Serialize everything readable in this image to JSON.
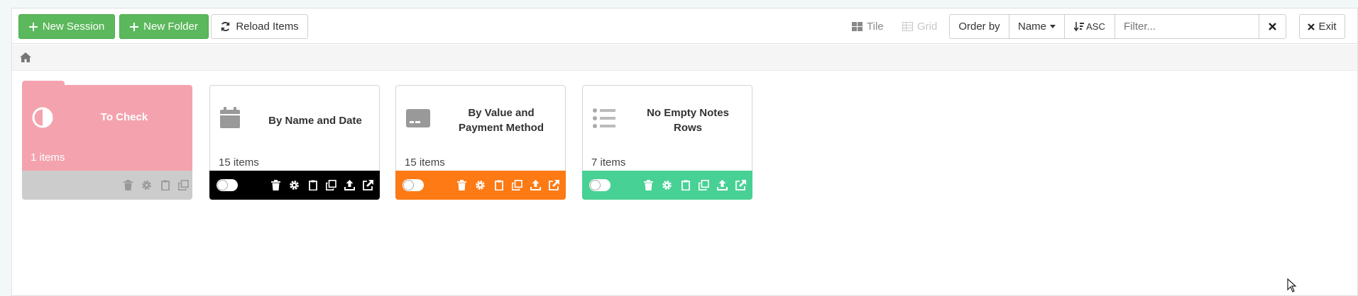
{
  "toolbar": {
    "new_session": "New Session",
    "new_folder": "New Folder",
    "reload_items": "Reload Items",
    "view_tile": "Tile",
    "view_grid": "Grid",
    "order_by_label": "Order by",
    "order_by_value": "Name",
    "sort_direction": "ASC",
    "filter_placeholder": "Filter...",
    "exit": "Exit"
  },
  "colors": {
    "green": "#5cb85c",
    "folder_pink": "#f4a3ae",
    "folder_footer": "#cccccc",
    "black": "#000000",
    "orange": "#fd7a14",
    "teal": "#48d195"
  },
  "items": [
    {
      "title": "To Check",
      "count": "1 items",
      "icon": "contrast-icon",
      "type": "folder"
    },
    {
      "title": "By Name and Date",
      "count": "15 items",
      "icon": "calendar-icon",
      "type": "session"
    },
    {
      "title": "By Value and Payment Method",
      "count": "15 items",
      "icon": "credit-card-icon",
      "type": "session"
    },
    {
      "title": "No Empty Notes Rows",
      "count": "7 items",
      "icon": "list-icon",
      "type": "session"
    }
  ]
}
